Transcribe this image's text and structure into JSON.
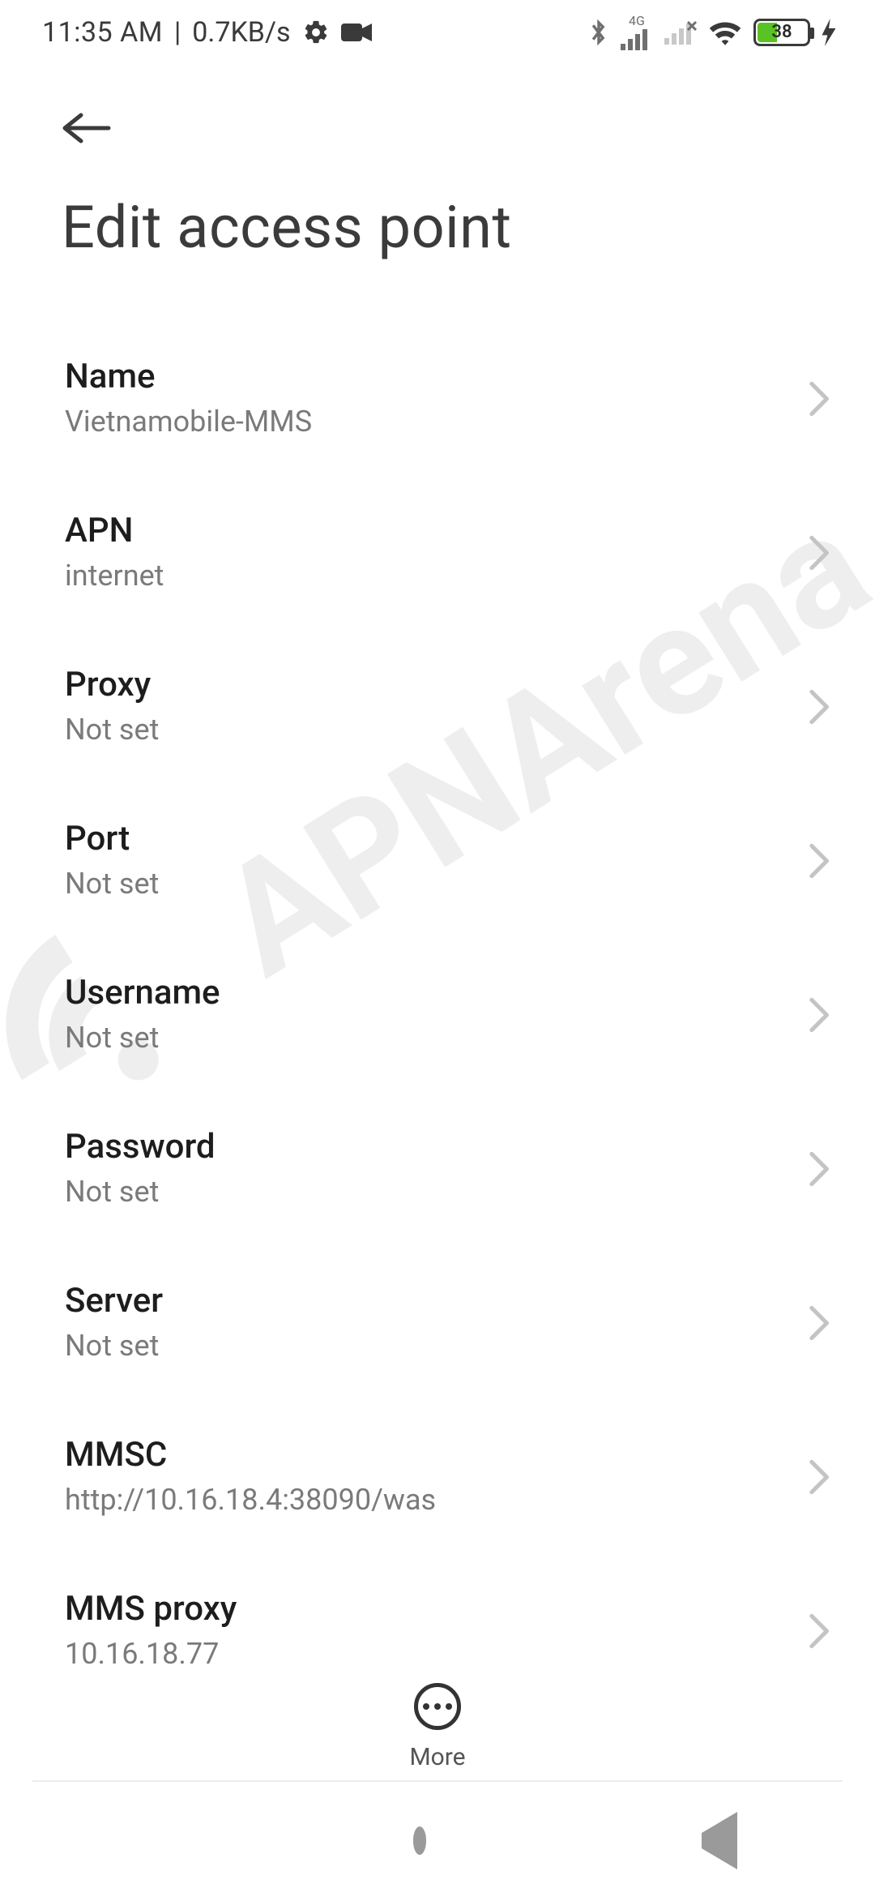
{
  "status": {
    "time": "11:35 AM",
    "separator": "|",
    "net_speed": "0.7KB/s",
    "signal_label": "4G",
    "battery_percent": "38"
  },
  "page": {
    "title": "Edit access point"
  },
  "settings": [
    {
      "label": "Name",
      "value": "Vietnamobile-MMS"
    },
    {
      "label": "APN",
      "value": "internet"
    },
    {
      "label": "Proxy",
      "value": "Not set"
    },
    {
      "label": "Port",
      "value": "Not set"
    },
    {
      "label": "Username",
      "value": "Not set"
    },
    {
      "label": "Password",
      "value": "Not set"
    },
    {
      "label": "Server",
      "value": "Not set"
    },
    {
      "label": "MMSC",
      "value": "http://10.16.18.4:38090/was"
    },
    {
      "label": "MMS proxy",
      "value": "10.16.18.77"
    }
  ],
  "more": {
    "label": "More"
  },
  "watermark": {
    "text": "APNArena"
  }
}
